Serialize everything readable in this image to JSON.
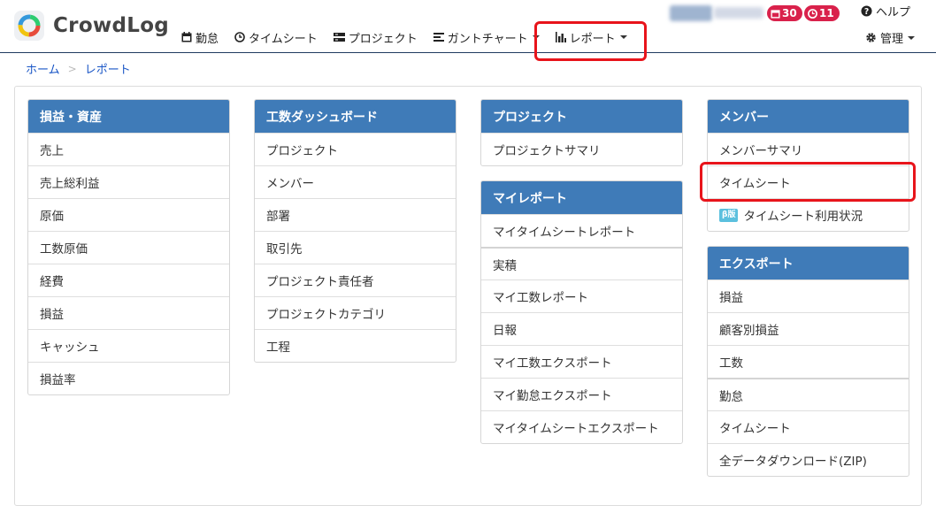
{
  "app": {
    "name": "CrowdLog"
  },
  "nav": {
    "items": [
      {
        "label": "勤怠",
        "icon": "calendar-icon"
      },
      {
        "label": "タイムシート",
        "icon": "clock-icon"
      },
      {
        "label": "プロジェクト",
        "icon": "project-icon"
      },
      {
        "label": "ガントチャート",
        "icon": "gantt-icon"
      },
      {
        "label": "レポート",
        "icon": "bar-chart-icon"
      }
    ]
  },
  "header": {
    "badge_calendar": "30",
    "badge_clock": "11",
    "help_label": "ヘルプ",
    "admin_label": "管理"
  },
  "breadcrumb": {
    "home": "ホーム",
    "current": "レポート"
  },
  "cards": {
    "profit": {
      "title": "損益・資産",
      "items": [
        "売上",
        "売上総利益",
        "原価",
        "工数原価",
        "経費",
        "損益",
        "キャッシュ",
        "損益率"
      ]
    },
    "dashboard": {
      "title": "工数ダッシュボード",
      "items": [
        "プロジェクト",
        "メンバー",
        "部署",
        "取引先",
        "プロジェクト責任者",
        "プロジェクトカテゴリ",
        "工程"
      ]
    },
    "project": {
      "title": "プロジェクト",
      "items": [
        "プロジェクトサマリ"
      ]
    },
    "my_report": {
      "title": "マイレポート",
      "items": [
        "マイタイムシートレポート",
        "実積",
        "マイ工数レポート",
        "日報",
        "マイ工数エクスポート",
        "マイ勤怠エクスポート",
        "マイタイムシートエクスポート"
      ]
    },
    "member": {
      "title": "メンバー",
      "items": [
        "メンバーサマリ",
        "タイムシート",
        "タイムシート利用状況"
      ],
      "beta_label": "β版"
    },
    "export": {
      "title": "エクスポート",
      "items": [
        "損益",
        "顧客別損益",
        "工数",
        "勤怠",
        "タイムシート",
        "全データダウンロード(ZIP)"
      ]
    }
  },
  "colors": {
    "card_header": "#3f7bb8",
    "badge": "#d9214b",
    "highlight": "#e8141b",
    "link": "#1a56c6"
  }
}
